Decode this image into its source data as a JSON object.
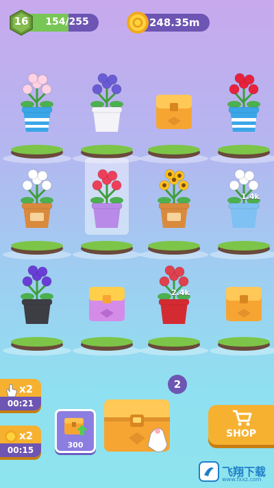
{
  "hud": {
    "level": "16",
    "xp_text": "154/255",
    "xp_progress": 0.604,
    "coins": "248.35m"
  },
  "grid": [
    {
      "item": "lily",
      "pot": "blue-striped"
    },
    {
      "item": "bluebell",
      "pot": "white-vase"
    },
    {
      "item": "chest",
      "pot": ""
    },
    {
      "item": "carnation",
      "pot": "blue-striped"
    },
    {
      "item": "lily-of-the-valley",
      "pot": "terracotta"
    },
    {
      "item": "tulip",
      "pot": "purple",
      "highlighted": true
    },
    {
      "item": "sunflower",
      "pot": "terracotta"
    },
    {
      "item": "calla-lily",
      "pot": "blue",
      "badge": "1.4k"
    },
    {
      "item": "morning-glory",
      "pot": "black-swirl"
    },
    {
      "item": "chest-purple",
      "pot": ""
    },
    {
      "item": "rose",
      "pot": "red",
      "badge": "2.4k"
    },
    {
      "item": "chest",
      "pot": ""
    }
  ],
  "boosts": [
    {
      "multiplier": "x2",
      "icon": "hand-icon",
      "timer": "00:21"
    },
    {
      "multiplier": "x2",
      "icon": "coin-icon",
      "timer": "00:15"
    }
  ],
  "upgrade": {
    "cost": "300"
  },
  "chest_count": "2",
  "shop": {
    "label": "SHOP"
  },
  "watermark": {
    "text": "飞翔下载",
    "sub": "www.fxxz.com"
  },
  "colors": {
    "accent": "#6d55b3",
    "gold": "#f6b131",
    "xp": "#78c655"
  }
}
